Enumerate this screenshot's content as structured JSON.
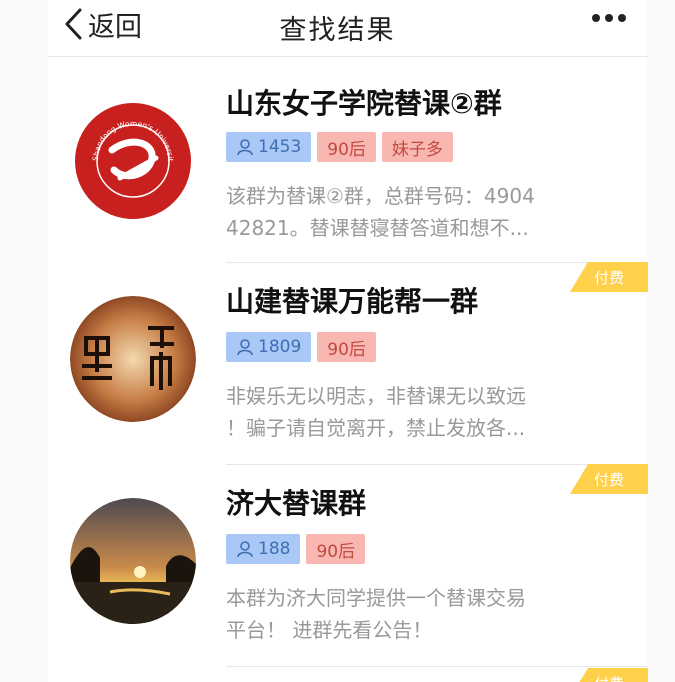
{
  "header": {
    "back_label": "返回",
    "title": "查找结果"
  },
  "groups": [
    {
      "name": "山东女子学院替课②群",
      "member_count": "1453",
      "tags": [
        "90后",
        "妹子多"
      ],
      "desc_line1": "该群为替课②群，总群号码：4904",
      "desc_line2": "42821。替课替寝替答道和想不...",
      "avatar": "shandong-womens-university-logo",
      "logo_text": "Shandong Women's University",
      "paid_label": ""
    },
    {
      "name": "山建替课万能帮一群",
      "member_count": "1809",
      "tags": [
        "90后"
      ],
      "desc_line1": "非娱乐无以明志，非替课无以致远",
      "desc_line2": "！骗子请自觉离开，禁止发放各...",
      "avatar": "calligraphy-heibang",
      "paid_label": "付费"
    },
    {
      "name": "济大替课群",
      "member_count": "188",
      "tags": [
        "90后"
      ],
      "desc_line1": "本群为济大同学提供一个替课交易",
      "desc_line2": "平台！ 进群先看公告！",
      "avatar": "sunset-lake-photo",
      "paid_label": "付费"
    }
  ],
  "bottom_paid_label": "付费",
  "colors": {
    "count_tag_bg": "#a9c8f6",
    "count_tag_text": "#3f6fb3",
    "pink_tag_bg": "#f9b7b2",
    "pink_tag_text": "#c04a3f",
    "paid_badge": "#ffd04a",
    "desc_text": "#999999"
  }
}
